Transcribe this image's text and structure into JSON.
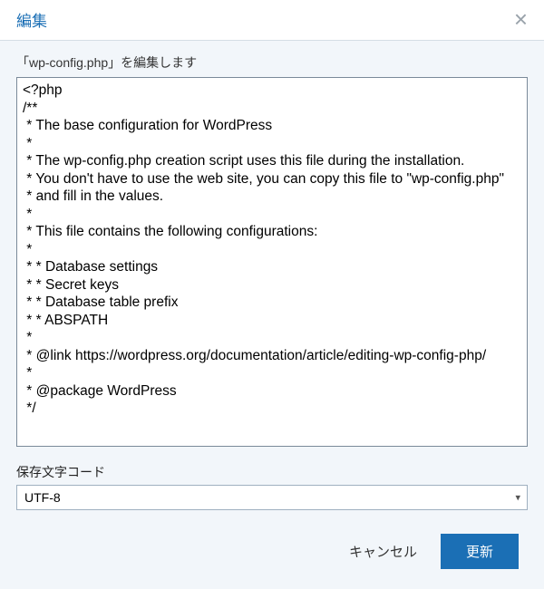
{
  "header": {
    "title": "編集",
    "close_icon": "×"
  },
  "body": {
    "instruction": "「wp-config.php」を編集します",
    "code_content": "<?php\n/**\n * The base configuration for WordPress\n *\n * The wp-config.php creation script uses this file during the installation.\n * You don't have to use the web site, you can copy this file to \"wp-config.php\"\n * and fill in the values.\n *\n * This file contains the following configurations:\n *\n * * Database settings\n * * Secret keys\n * * Database table prefix\n * * ABSPATH\n *\n * @link https://wordpress.org/documentation/article/editing-wp-config-php/\n *\n * @package WordPress\n */",
    "encoding_label": "保存文字コード",
    "encoding_value": "UTF-8"
  },
  "footer": {
    "cancel_label": "キャンセル",
    "update_label": "更新"
  }
}
